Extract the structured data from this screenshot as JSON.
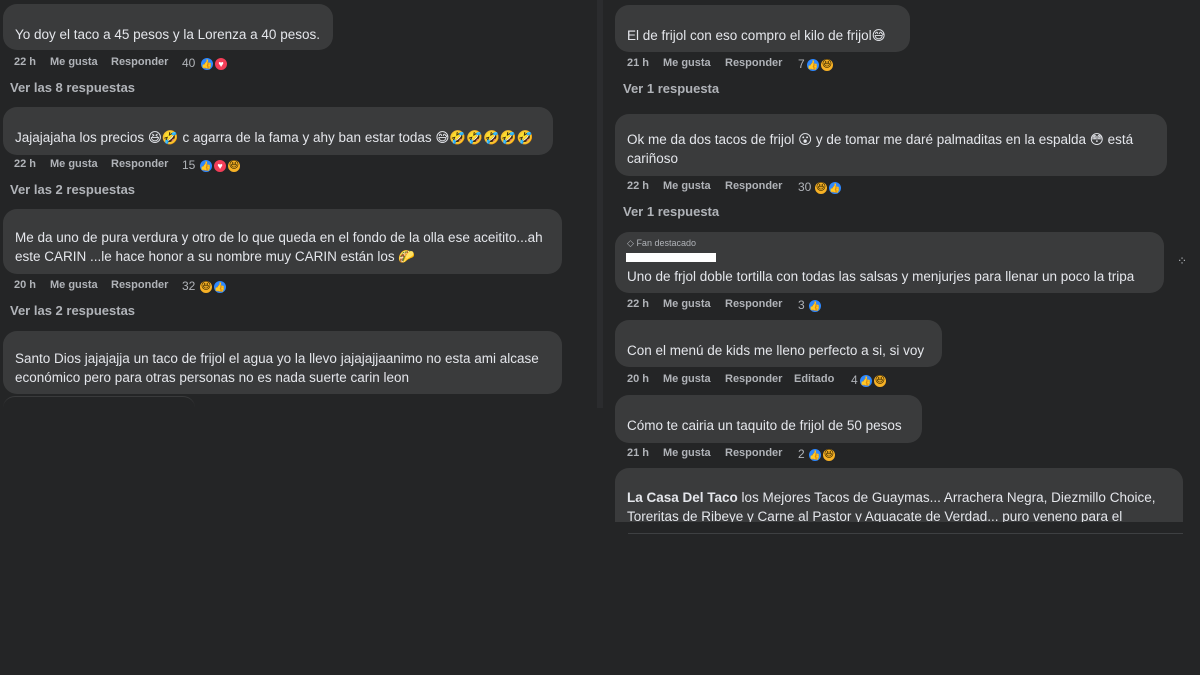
{
  "left": {
    "comments": [
      {
        "text": "Yo doy el taco a 45 pesos y la Lorenza a 40 pesos.",
        "time": "22 h",
        "like": "Me gusta",
        "reply": "Responder",
        "count": "40",
        "reactions": [
          "like-icon",
          "love-icon"
        ],
        "replies": "Ver las 8 respuestas"
      },
      {
        "text": "Jajajajaha los precios 😆🤣 c agarra de la fama y ahy ban estar todas 😅🤣🤣🤣🤣🤣",
        "time": "22 h",
        "like": "Me gusta",
        "reply": "Responder",
        "count": "15",
        "reactions": [
          "like-icon",
          "love-icon",
          "haha-icon"
        ],
        "replies": "Ver las 2 respuestas"
      },
      {
        "line1": "Me da uno de pura verdura y otro de lo que queda en el fondo de la olla ese aceitito...ah",
        "line2": "este CARIN ...le hace honor a su nombre muy CARIN están los 🌮",
        "time": "20 h",
        "like": "Me gusta",
        "reply": "Responder",
        "count": "32",
        "reactions": [
          "haha-icon",
          "like-icon"
        ],
        "replies": "Ver las 2 respuestas"
      },
      {
        "line1": "Santo Dios jajajajja un taco de frijol el agua yo la llevo jajajajjaanimo no esta ami alcase",
        "line2": "económico pero para otras personas no es nada suerte carin leon"
      }
    ]
  },
  "right": {
    "comments": [
      {
        "text": "El de frijol con eso compro el kilo de frijol😅",
        "time": "21 h",
        "like": "Me gusta",
        "reply": "Responder",
        "count": "7",
        "reactions": [
          "like-icon",
          "haha-icon"
        ],
        "replies": "Ver 1 respuesta"
      },
      {
        "line1": "Ok me da dos tacos de frijol 😮 y de tomar me daré palmaditas en la espalda 😳 está",
        "line2": "cariñoso",
        "time": "22 h",
        "like": "Me gusta",
        "reply": "Responder",
        "count": "30",
        "reactions": [
          "haha-icon",
          "like-icon"
        ],
        "replies": "Ver 1 respuesta"
      },
      {
        "badge": "Fan destacado",
        "text": "Uno de frjol doble tortilla con todas las salsas y menjurjes para llenar un poco la tripa",
        "time": "22 h",
        "like": "Me gusta",
        "reply": "Responder",
        "count": "3",
        "reactions": [
          "like-icon"
        ]
      },
      {
        "text": "Con el menú de kids me lleno perfecto a si, si voy",
        "time": "20 h",
        "like": "Me gusta",
        "reply": "Responder",
        "edited": "Editado",
        "count": "4",
        "reactions": [
          "like-icon",
          "haha-icon"
        ]
      },
      {
        "text": "Cómo te cairia un taquito de frijol de 50 pesos",
        "time": "21 h",
        "like": "Me gusta",
        "reply": "Responder",
        "count": "2",
        "reactions": [
          "like-icon",
          "haha-icon"
        ]
      },
      {
        "page_name": "La Casa Del Taco",
        "line1_rest": " los Mejores Tacos de Guaymas... Arrachera Negra, Diezmillo Choice,",
        "line2": "Toreritas de Ribeye y Carne al Pastor y Aguacate de Verdad... puro veneno para el"
      }
    ]
  },
  "side_mark": "⁘",
  "colors": {
    "background": "#242526",
    "bubble": "#3a3b3c",
    "text": "#e4e6eb",
    "meta": "#b0b3b8",
    "like": "#2d88ff",
    "love": "#f33e58",
    "haha": "#f7b125"
  }
}
